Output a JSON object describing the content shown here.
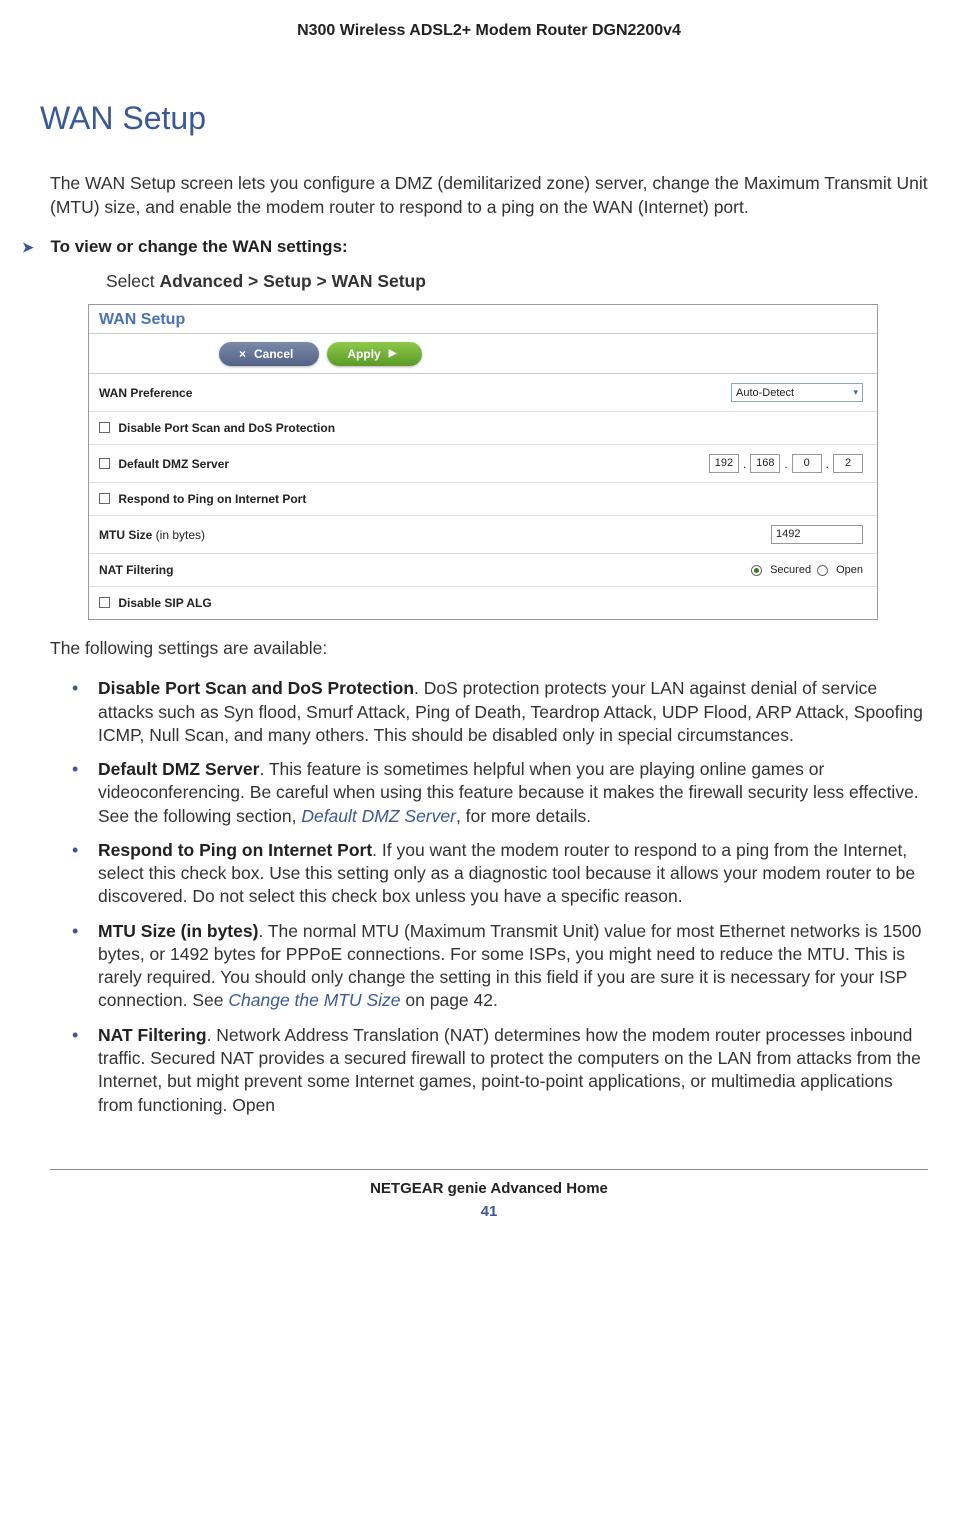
{
  "header": {
    "product": "N300 Wireless ADSL2+ Modem Router DGN2200v4"
  },
  "section": {
    "heading": "WAN Setup"
  },
  "intro": "The WAN Setup screen lets you configure a DMZ (demilitarized zone) server, change the Maximum Transmit Unit (MTU) size, and enable the modem router to respond to a ping on the WAN (Internet) port.",
  "proc": {
    "heading": "To view or change the WAN settings:",
    "step_prefix": "Select ",
    "step_path": "Advanced > Setup > WAN Setup"
  },
  "screenshot": {
    "title": "WAN Setup",
    "cancel": "Cancel",
    "apply": "Apply",
    "wan_pref_label": "WAN Preference",
    "wan_pref_value": "Auto-Detect",
    "disable_port_scan": "Disable Port Scan and DoS Protection",
    "default_dmz": "Default DMZ Server",
    "dmz_ip": [
      "192",
      "168",
      "0",
      "2"
    ],
    "respond_ping": "Respond to Ping on Internet Port",
    "mtu_label": "MTU Size",
    "mtu_sub": " (in bytes)",
    "mtu_value": "1492",
    "nat_label": "NAT Filtering",
    "nat_secured": "Secured",
    "nat_open": "Open",
    "disable_sip": "Disable SIP ALG"
  },
  "following": "The following settings are available:",
  "bullets": {
    "b1_title": "Disable Port Scan and DoS Protection",
    "b1_body": ". DoS protection protects your LAN against denial of service attacks such as Syn flood, Smurf Attack, Ping of Death, Teardrop Attack, UDP Flood, ARP Attack, Spoofing ICMP, Null Scan, and many others. This should be disabled only in special circumstances.",
    "b2_title": "Default DMZ Server",
    "b2_body_a": ". This feature is sometimes helpful when you are playing online games or videoconferencing. Be careful when using this feature because it makes the firewall security less effective. See the following section, ",
    "b2_link": "Default DMZ Server",
    "b2_body_b": ", for more details.",
    "b3_title": "Respond to Ping on Internet Port",
    "b3_body": ". If you want the modem router to respond to a ping from the Internet, select this check box. Use this setting only as a diagnostic tool because it allows your modem router to be discovered. Do not select this check box unless you have a specific reason.",
    "b4_title": "MTU Size (in bytes)",
    "b4_body_a": ". The normal MTU (Maximum Transmit Unit) value for most Ethernet networks is 1500 bytes, or 1492 bytes for PPPoE connections. For some ISPs, you might need to reduce the MTU. This is rarely required. You should only change the setting in this field if you are sure it is necessary for your ISP connection. See ",
    "b4_link": "Change the MTU Size",
    "b4_body_b": " on page 42.",
    "b5_title": "NAT Filtering",
    "b5_body": ". Network Address Translation (NAT) determines how the modem router processes inbound traffic. Secured NAT provides a secured firewall to protect the computers on the LAN from attacks from the Internet, but might prevent some Internet games, point-to-point applications, or multimedia applications from functioning. Open"
  },
  "footer": {
    "text": "NETGEAR genie Advanced Home",
    "page": "41"
  }
}
